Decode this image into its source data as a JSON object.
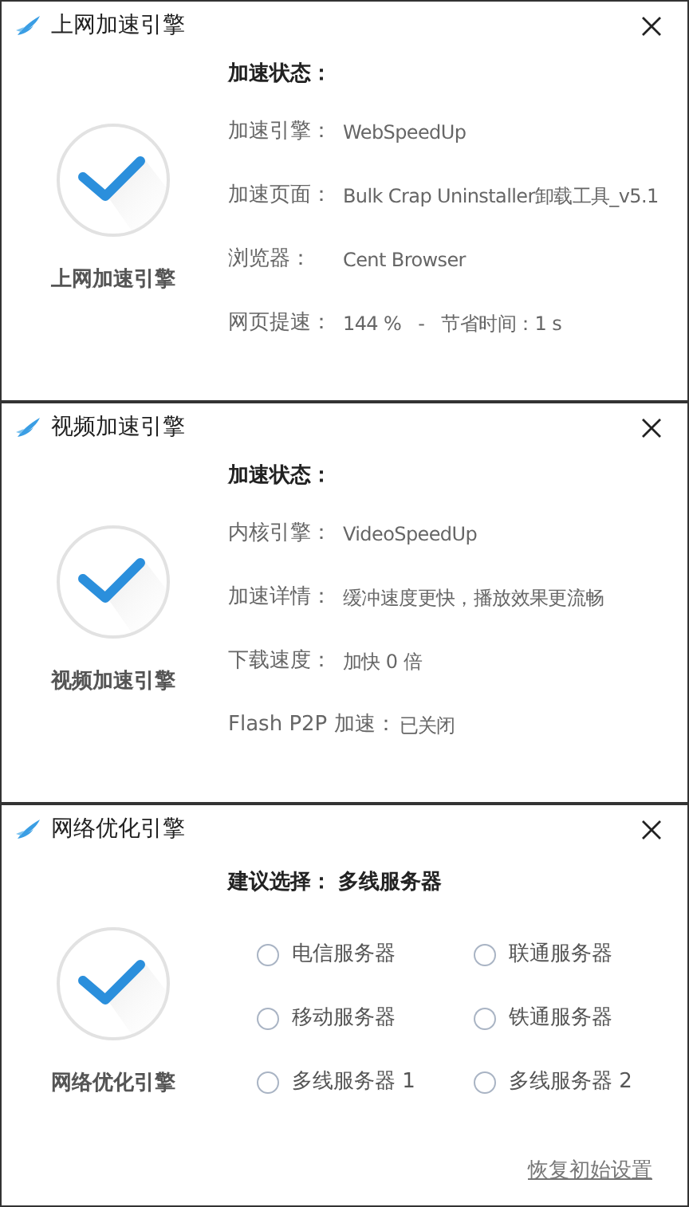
{
  "panels": [
    {
      "kind": "status",
      "title": "上网加速引擎",
      "engine_label": "上网加速引擎",
      "heading": {
        "label": "加速状态："
      },
      "rows": [
        {
          "kind": "aligned",
          "label": "加速引擎：",
          "value": "WebSpeedUp"
        },
        {
          "kind": "aligned",
          "label": "加速页面：",
          "value": "Bulk Crap Uninstaller卸载工具_v5.1"
        },
        {
          "kind": "aligned",
          "label": "浏览器：",
          "value": "Cent Browser"
        },
        {
          "kind": "aligned",
          "label": "网页提速：",
          "value": "144 %   -   节省时间：1 s"
        }
      ]
    },
    {
      "kind": "status",
      "title": "视频加速引擎",
      "engine_label": "视频加速引擎",
      "heading": {
        "label": "加速状态："
      },
      "rows": [
        {
          "kind": "aligned",
          "label": "内核引擎：",
          "value": "VideoSpeedUp"
        },
        {
          "kind": "aligned",
          "label": "加速详情：",
          "value": "缓冲速度更快，播放效果更流畅"
        },
        {
          "kind": "aligned",
          "label": "下载速度：",
          "value": "加快 0 倍"
        },
        {
          "kind": "inline",
          "label": "Flash P2P 加速：",
          "value": "已关闭"
        }
      ]
    },
    {
      "kind": "servers",
      "title": "网络优化引擎",
      "engine_label": "网络优化引擎",
      "heading": {
        "label": "建议选择：",
        "value": "多线服务器"
      },
      "options": [
        {
          "label": "电信服务器",
          "selected": false
        },
        {
          "label": "联通服务器",
          "selected": false
        },
        {
          "label": "移动服务器",
          "selected": false
        },
        {
          "label": "铁通服务器",
          "selected": false
        },
        {
          "label": "多线服务器 1",
          "selected": false
        },
        {
          "label": "多线服务器 2",
          "selected": false
        }
      ],
      "link": "恢复初始设置"
    }
  ]
}
